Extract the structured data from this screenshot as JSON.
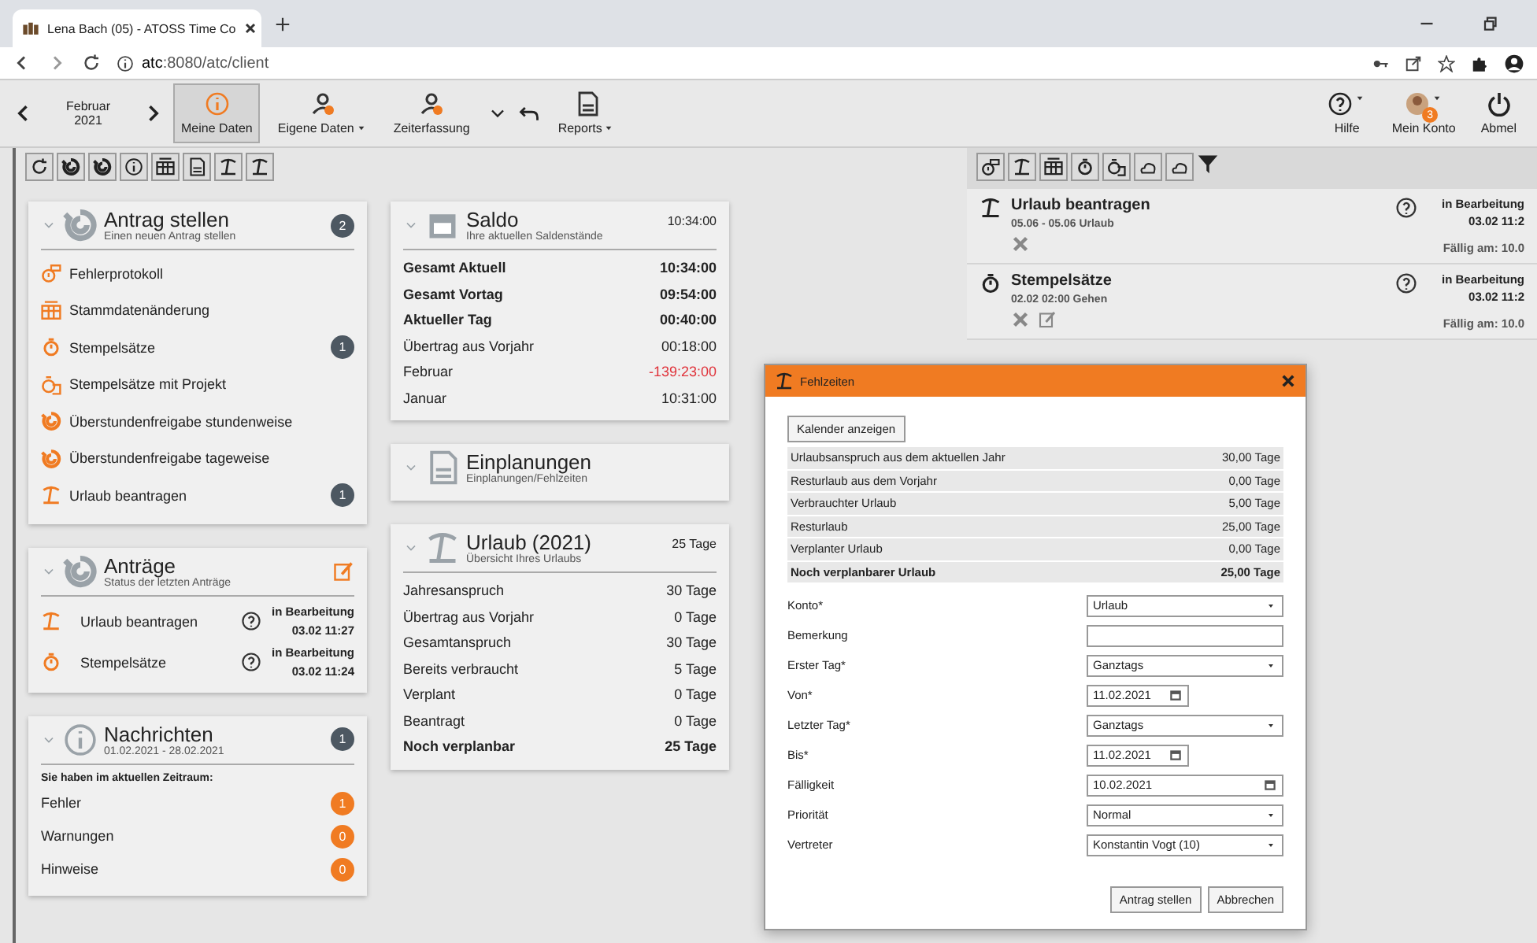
{
  "browser": {
    "tab_title": "Lena Bach (05) - ATOSS Time Co",
    "url_host": "atc",
    "url_rest": ":8080/atc/client"
  },
  "toolbar": {
    "month": "Februar",
    "year": "2021",
    "buttons": [
      {
        "label": "Meine Daten",
        "selected": true,
        "dropdown": false
      },
      {
        "label": "Eigene Daten",
        "selected": false,
        "dropdown": true
      },
      {
        "label": "Zeiterfassung",
        "selected": false,
        "dropdown": false
      },
      {
        "label": "Reports",
        "selected": false,
        "dropdown": true
      }
    ],
    "right_buttons": [
      {
        "kind": "help",
        "label": "Hilfe",
        "dropdown": true
      },
      {
        "kind": "account",
        "label": "Mein Konto",
        "dropdown": true,
        "badge": "3"
      },
      {
        "kind": "logout",
        "label": "Abmel",
        "dropdown": false
      }
    ]
  },
  "antrag_stellen": {
    "title": "Antrag stellen",
    "subtitle": "Einen neuen Antrag stellen",
    "count": "2",
    "items": [
      {
        "label": "Fehlerprotokoll"
      },
      {
        "label": "Stammdatenänderung"
      },
      {
        "label": "Stempelsätze",
        "count": "1"
      },
      {
        "label": "Stempelsätze mit Projekt"
      },
      {
        "label": "Überstundenfreigabe stundenweise"
      },
      {
        "label": "Überstundenfreigabe tageweise"
      },
      {
        "label": "Urlaub beantragen",
        "count": "1"
      }
    ]
  },
  "antraege": {
    "title": "Anträge",
    "subtitle": "Status der letzten Anträge",
    "items": [
      {
        "label": "Urlaub beantragen",
        "status": "in Bearbeitung",
        "time": "03.02 11:27"
      },
      {
        "label": "Stempelsätze",
        "status": "in Bearbeitung",
        "time": "03.02 11:24"
      }
    ]
  },
  "nachrichten": {
    "title": "Nachrichten",
    "subtitle": "01.02.2021 - 28.02.2021",
    "count": "1",
    "intro": "Sie haben im aktuellen Zeitraum:",
    "items": [
      {
        "label": "Fehler",
        "count": "1"
      },
      {
        "label": "Warnungen",
        "count": "0"
      },
      {
        "label": "Hinweise",
        "count": "0"
      }
    ]
  },
  "saldo": {
    "title": "Saldo",
    "subtitle": "Ihre aktuellen Saldenstände",
    "value": "10:34:00",
    "rows": [
      {
        "label": "Gesamt Aktuell",
        "value": "10:34:00",
        "bold": true,
        "negative": false
      },
      {
        "label": "Gesamt Vortag",
        "value": "09:54:00",
        "bold": true,
        "negative": false
      },
      {
        "label": "Aktueller Tag",
        "value": "00:40:00",
        "bold": true,
        "negative": false
      },
      {
        "label": "Übertrag aus Vorjahr",
        "value": "00:18:00",
        "bold": false,
        "negative": false
      },
      {
        "label": "Februar",
        "value": "-139:23:00",
        "bold": false,
        "negative": true
      },
      {
        "label": "Januar",
        "value": "10:31:00",
        "bold": false,
        "negative": false
      }
    ]
  },
  "einplanungen": {
    "title": "Einplanungen",
    "subtitle": "Einplanungen/Fehlzeiten"
  },
  "urlaub": {
    "title": "Urlaub (2021)",
    "subtitle": "Übersicht Ihres Urlaubs",
    "value": "25 Tage",
    "rows": [
      {
        "label": "Jahresanspruch",
        "value": "30 Tage",
        "bold": false
      },
      {
        "label": "Übertrag aus Vorjahr",
        "value": "0 Tage",
        "bold": false
      },
      {
        "label": "Gesamtanspruch",
        "value": "30 Tage",
        "bold": false
      },
      {
        "label": "Bereits verbraucht",
        "value": "5 Tage",
        "bold": false
      },
      {
        "label": "Verplant",
        "value": "0 Tage",
        "bold": false
      },
      {
        "label": "Beantragt",
        "value": "0 Tage",
        "bold": false
      },
      {
        "label": "Noch verplanbar",
        "value": "25 Tage",
        "bold": true
      }
    ]
  },
  "requests": [
    {
      "title": "Urlaub beantragen",
      "detail": "05.06 - 05.06 Urlaub",
      "status": "in Bearbeitung",
      "time": "03.02 11:2",
      "due": "Fällig am: 10.0",
      "editable": false
    },
    {
      "title": "Stempelsätze",
      "detail": "02.02 02:00 Gehen",
      "status": "in Bearbeitung",
      "time": "03.02 11:2",
      "due": "Fällig am: 10.0",
      "editable": true
    }
  ],
  "dialog": {
    "title": "Fehlzeiten",
    "calendar_button": "Kalender anzeigen",
    "summary": [
      {
        "label": "Urlaubsanspruch aus dem aktuellen Jahr",
        "value": "30,00 Tage",
        "bold": false
      },
      {
        "label": "Resturlaub aus dem Vorjahr",
        "value": "0,00 Tage",
        "bold": false
      },
      {
        "label": "Verbrauchter Urlaub",
        "value": "5,00 Tage",
        "bold": false
      },
      {
        "label": "Resturlaub",
        "value": "25,00 Tage",
        "bold": false
      },
      {
        "label": "Verplanter Urlaub",
        "value": "0,00 Tage",
        "bold": false
      },
      {
        "label": "Noch verplanbarer Urlaub",
        "value": "25,00 Tage",
        "bold": true
      }
    ],
    "fields": [
      {
        "label": "Konto*",
        "kind": "select",
        "value": "Urlaub"
      },
      {
        "label": "Bemerkung",
        "kind": "text"
      },
      {
        "label": "Erster Tag*",
        "kind": "select",
        "value": "Ganztags"
      },
      {
        "label": "Von*",
        "kind": "date",
        "value": "11.02.2021",
        "wide": false
      },
      {
        "label": "Letzter Tag*",
        "kind": "select",
        "value": "Ganztags"
      },
      {
        "label": "Bis*",
        "kind": "date",
        "value": "11.02.2021",
        "wide": false
      },
      {
        "label": "Fälligkeit",
        "kind": "date",
        "value": "10.02.2021",
        "wide": true
      },
      {
        "label": "Priorität",
        "kind": "select",
        "value": "Normal"
      },
      {
        "label": "Vertreter",
        "kind": "select",
        "value": "Konstantin Vogt (10)"
      }
    ],
    "buttons": [
      "Antrag stellen",
      "Abbrechen"
    ]
  }
}
